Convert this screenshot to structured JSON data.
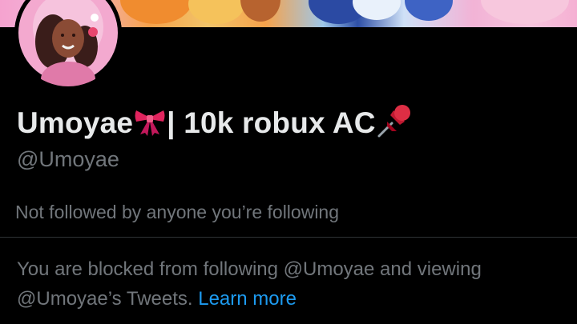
{
  "profile": {
    "display_name": "Umoyae",
    "name_suffix": "| 10k robux AC",
    "bow_icon": "ribbon-emoji",
    "pin_icon": "pushpin-emoji",
    "handle": "@Umoyae",
    "followed_note": "Not followed by anyone you’re following"
  },
  "blocked": {
    "text": "You are blocked from following @Umoyae and viewing @Umoyae’s Tweets.",
    "link_label": "Learn more"
  },
  "colors": {
    "background": "#000000",
    "primary_text": "#e7e9ea",
    "secondary_text": "#71767b",
    "link": "#1d9bf0",
    "divider": "#2f3336"
  }
}
